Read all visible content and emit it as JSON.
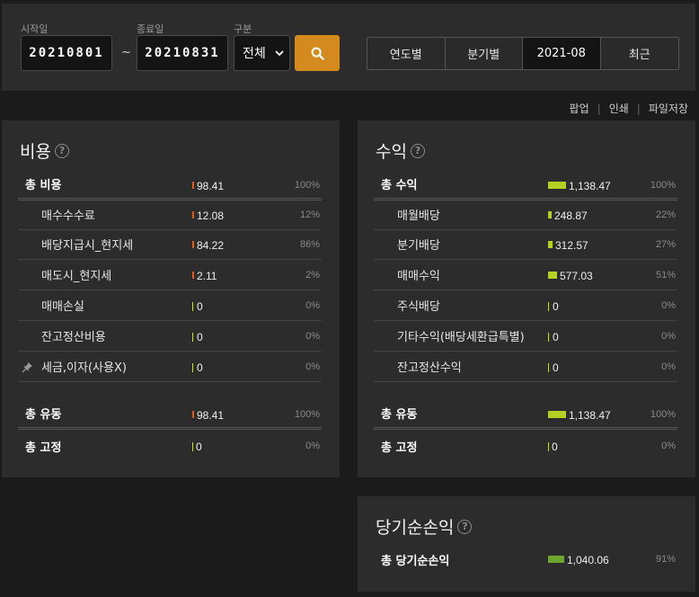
{
  "filters": {
    "start_label": "시작일",
    "start_value": "20210801",
    "end_label": "종료일",
    "end_value": "20210831",
    "tilde": "~",
    "type_label": "구분",
    "type_value": "전체",
    "period_tabs": [
      {
        "label": "연도별"
      },
      {
        "label": "분기별"
      },
      {
        "label": "2021-08",
        "active": true
      },
      {
        "label": "최근"
      }
    ]
  },
  "utils": [
    "팝업",
    "인쇄",
    "파일저장"
  ],
  "colors": {
    "expense_bar": "#e05a1a",
    "income_bar": "#b5cf22",
    "net_bar": "#6ea52c",
    "search_button": "#d48a1c"
  },
  "expense": {
    "title": "비용",
    "help": "?",
    "rows": [
      {
        "label": "총 비용",
        "value": "98.41",
        "pct": "100%",
        "fraction": 0.0087,
        "total": true
      },
      {
        "label": "매수수수료",
        "value": "12.08",
        "pct": "12%",
        "fraction": 0.0087
      },
      {
        "label": "배당지급시_현지세",
        "value": "84.22",
        "pct": "86%",
        "fraction": 0.0087
      },
      {
        "label": "매도시_현지세",
        "value": "2.11",
        "pct": "2%",
        "fraction": 0.0087
      },
      {
        "label": "매매손실",
        "value": "0",
        "pct": "0%",
        "fraction": 0
      },
      {
        "label": "잔고정산비용",
        "value": "0",
        "pct": "0%",
        "fraction": 0
      },
      {
        "label": "세금,이자(사용X)",
        "value": "0",
        "pct": "0%",
        "fraction": 0,
        "pinned": true
      }
    ],
    "flow": {
      "label": "총 유동",
      "value": "98.41",
      "pct": "100%"
    },
    "fixed": {
      "label": "총 고정",
      "value": "0",
      "pct": "0%"
    }
  },
  "income": {
    "title": "수익",
    "help": "?",
    "rows": [
      {
        "label": "총 수익",
        "value": "1,138.47",
        "pct": "100%",
        "fraction": 1.0,
        "total": true
      },
      {
        "label": "매월배당",
        "value": "248.87",
        "pct": "22%",
        "fraction": 0.22
      },
      {
        "label": "분기배당",
        "value": "312.57",
        "pct": "27%",
        "fraction": 0.27
      },
      {
        "label": "매매수익",
        "value": "577.03",
        "pct": "51%",
        "fraction": 0.51
      },
      {
        "label": "주식배당",
        "value": "0",
        "pct": "0%",
        "fraction": 0
      },
      {
        "label": "기타수익(배당세환급특별)",
        "value": "0",
        "pct": "0%",
        "fraction": 0
      },
      {
        "label": "잔고정산수익",
        "value": "0",
        "pct": "0%",
        "fraction": 0
      }
    ],
    "flow": {
      "label": "총 유동",
      "value": "1,138.47",
      "pct": "100%"
    },
    "fixed": {
      "label": "총 고정",
      "value": "0",
      "pct": "0%"
    }
  },
  "net": {
    "title": "당기순손익",
    "help": "?",
    "total": {
      "label": "총 당기순손익",
      "value": "1,040.06",
      "pct": "91%"
    }
  }
}
